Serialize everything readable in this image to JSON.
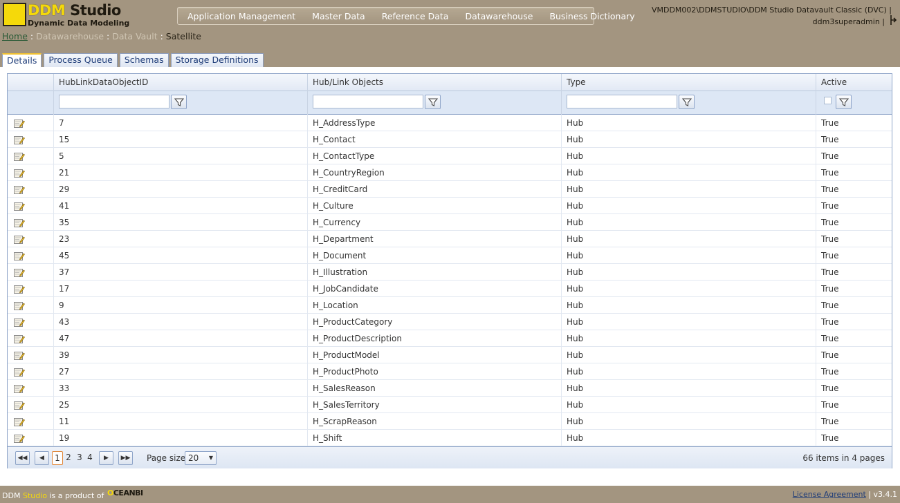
{
  "header": {
    "logo_title_a": "DDM",
    "logo_title_b": " Studio",
    "logo_subtitle": "Dynamic Data Modeling",
    "menu": [
      "Application Management",
      "Master Data",
      "Reference Data",
      "Datawarehouse",
      "Business Dictionary"
    ],
    "server": "VMDDM002\\DDMSTUDIO\\DDM Studio Datavault Classic (DVC) |",
    "user": "ddm3superadmin |"
  },
  "breadcrumb": {
    "home": "Home",
    "sep": " : ",
    "level1": "Datawarehouse",
    "level2": "Data Vault",
    "current": "Satellite"
  },
  "tabs": [
    "Details",
    "Process Queue",
    "Schemas",
    "Storage Definitions"
  ],
  "grid": {
    "columns": [
      "HubLinkDataObjectID",
      "Hub/Link Objects",
      "Type",
      "Active"
    ],
    "rows": [
      {
        "id": "7",
        "name": "H_AddressType",
        "type": "Hub",
        "active": "True"
      },
      {
        "id": "15",
        "name": "H_Contact",
        "type": "Hub",
        "active": "True"
      },
      {
        "id": "5",
        "name": "H_ContactType",
        "type": "Hub",
        "active": "True"
      },
      {
        "id": "21",
        "name": "H_CountryRegion",
        "type": "Hub",
        "active": "True"
      },
      {
        "id": "29",
        "name": "H_CreditCard",
        "type": "Hub",
        "active": "True"
      },
      {
        "id": "41",
        "name": "H_Culture",
        "type": "Hub",
        "active": "True"
      },
      {
        "id": "35",
        "name": "H_Currency",
        "type": "Hub",
        "active": "True"
      },
      {
        "id": "23",
        "name": "H_Department",
        "type": "Hub",
        "active": "True"
      },
      {
        "id": "45",
        "name": "H_Document",
        "type": "Hub",
        "active": "True"
      },
      {
        "id": "37",
        "name": "H_Illustration",
        "type": "Hub",
        "active": "True"
      },
      {
        "id": "17",
        "name": "H_JobCandidate",
        "type": "Hub",
        "active": "True"
      },
      {
        "id": "9",
        "name": "H_Location",
        "type": "Hub",
        "active": "True"
      },
      {
        "id": "43",
        "name": "H_ProductCategory",
        "type": "Hub",
        "active": "True"
      },
      {
        "id": "47",
        "name": "H_ProductDescription",
        "type": "Hub",
        "active": "True"
      },
      {
        "id": "39",
        "name": "H_ProductModel",
        "type": "Hub",
        "active": "True"
      },
      {
        "id": "27",
        "name": "H_ProductPhoto",
        "type": "Hub",
        "active": "True"
      },
      {
        "id": "33",
        "name": "H_SalesReason",
        "type": "Hub",
        "active": "True"
      },
      {
        "id": "25",
        "name": "H_SalesTerritory",
        "type": "Hub",
        "active": "True"
      },
      {
        "id": "11",
        "name": "H_ScrapReason",
        "type": "Hub",
        "active": "True"
      },
      {
        "id": "19",
        "name": "H_Shift",
        "type": "Hub",
        "active": "True"
      }
    ]
  },
  "pager": {
    "pages": [
      "1",
      "2",
      "3",
      "4"
    ],
    "page_size_label": "Page size:",
    "page_size": "20",
    "info": "66 items in 4 pages"
  },
  "footer": {
    "left_a": "DDM ",
    "left_studio": "Studio",
    "left_b": " is a product of",
    "brand_o": "O",
    "brand_rest": "CEANBI",
    "license": "License Agreement",
    "version": " | v3.4.1"
  },
  "icons": {
    "filter": "filter-icon",
    "edit": "edit-icon",
    "logout": "logout-icon"
  }
}
